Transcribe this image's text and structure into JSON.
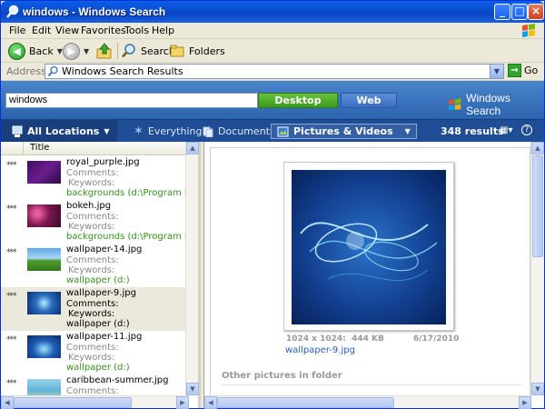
{
  "window": {
    "title": "windows - Windows Search"
  },
  "menu": [
    "File",
    "Edit",
    "View",
    "Favorites",
    "Tools",
    "Help"
  ],
  "toolbar": {
    "back_label": "Back",
    "search_label": "Search",
    "folders_label": "Folders"
  },
  "address": {
    "label": "Address",
    "value": "Windows Search Results",
    "go_label": "Go"
  },
  "search": {
    "query": "windows",
    "desktop_label": "Desktop",
    "web_label": "Web",
    "brand": "Windows Search"
  },
  "filters": {
    "location": "All Locations",
    "everything": "Everything",
    "documents": "Documents",
    "pictures": "Pictures & Videos",
    "results_count": "348 results"
  },
  "list": {
    "column_title": "Title",
    "rows": [
      {
        "rating": "***",
        "name": "royal_purple.jpg",
        "comments": "Comments:",
        "keywords": "Keywords:",
        "path": "backgrounds (d:\\Program Files\\wunde"
      },
      {
        "rating": "***",
        "name": "bokeh.jpg",
        "comments": "Comments:",
        "keywords": "Keywords:",
        "path": "backgrounds (d:\\Program Files\\wunde"
      },
      {
        "rating": "***",
        "name": "wallpaper-14.jpg",
        "comments": "Comments:",
        "keywords": "Keywords:",
        "path": "wallpaper (d:)"
      },
      {
        "rating": "***",
        "name": "wallpaper-9.jpg",
        "comments": "Comments:",
        "keywords": "Keywords:",
        "path": "wallpaper (d:)"
      },
      {
        "rating": "***",
        "name": "wallpaper-11.jpg",
        "comments": "Comments:",
        "keywords": "Keywords:",
        "path": "wallpaper (d:)"
      },
      {
        "rating": "***",
        "name": "caribbean-summer.jpg",
        "comments": "Comments:",
        "keywords": "",
        "path": ""
      }
    ],
    "selected_index": 3
  },
  "preview": {
    "dimensions": "1024 x 1024:",
    "size": "444 KB",
    "date": "6/17/2010",
    "filename": "wallpaper-9.jpg",
    "other_heading": "Other pictures in folder"
  },
  "colors": {
    "accent_blue": "#1f4e96",
    "desktop_green": "#3c9a1b",
    "path_green": "#36911b",
    "link_blue": "#2a5bc8"
  }
}
